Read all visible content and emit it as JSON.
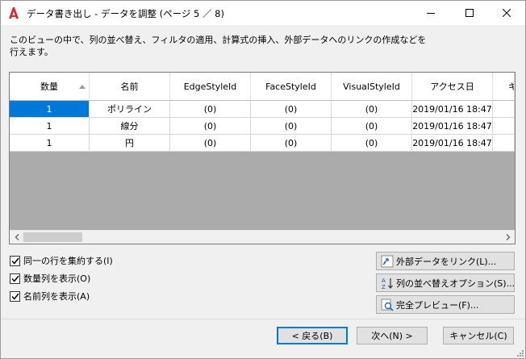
{
  "window": {
    "title": "データ書き出し - データを調整 (ページ 5 ／ 8)"
  },
  "description": "このビューの中で、列の並べ替え、フィルタの適用、計算式の挿入、外部データへのリンクの作成などを行えます。",
  "table": {
    "columns": [
      "数量",
      "名前",
      "EdgeStyleId",
      "FaceStyleId",
      "VisualStyleId",
      "アクセス日",
      "キ"
    ],
    "rows": [
      [
        "1",
        "ポリライン",
        "(0)",
        "(0)",
        "(0)",
        "2019/01/16 18:47",
        ""
      ],
      [
        "1",
        "線分",
        "(0)",
        "(0)",
        "(0)",
        "2019/01/16 18:47",
        ""
      ],
      [
        "1",
        "円",
        "(0)",
        "(0)",
        "(0)",
        "2019/01/16 18:47",
        ""
      ]
    ]
  },
  "options": {
    "group_rows": "同一の行を集約する(I)",
    "show_count": "数量列を表示(O)",
    "show_name": "名前列を表示(A)"
  },
  "buttons": {
    "link_external": "外部データをリンク(L)...",
    "sort_options": "列の並べ替えオプション(S)...",
    "full_preview": "完全プレビュー(F)...",
    "back": "< 戻る(B)",
    "next": "次へ(N) >",
    "cancel": "キャンセル(C)"
  }
}
